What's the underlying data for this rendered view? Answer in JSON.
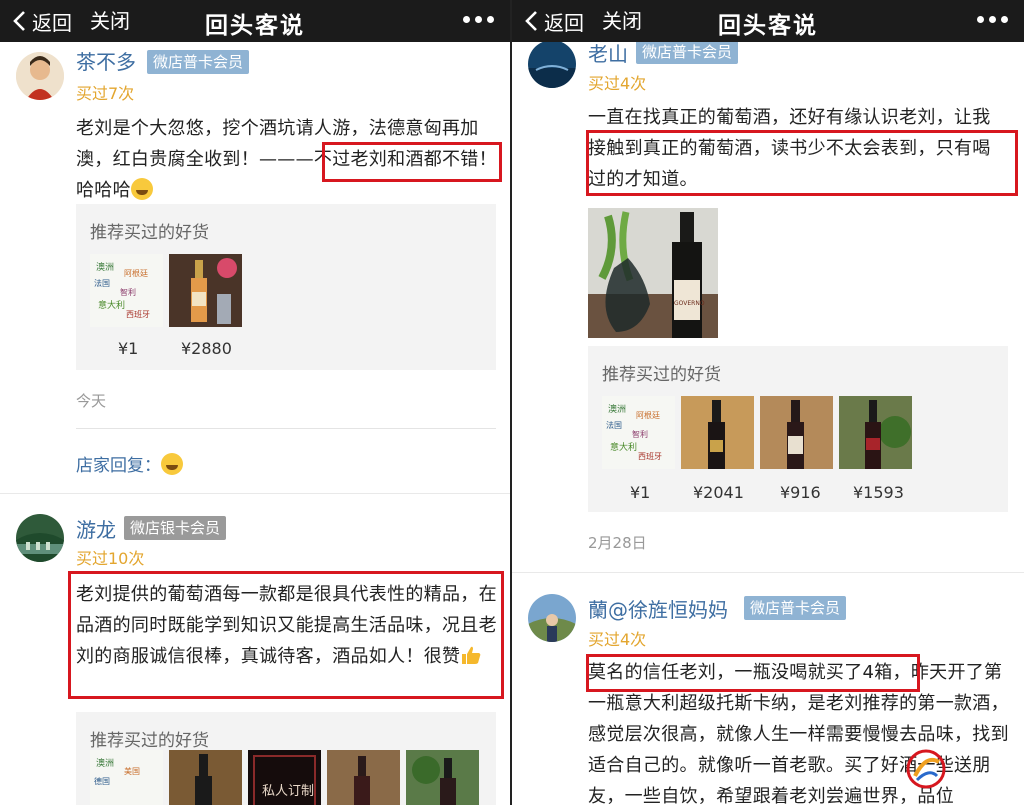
{
  "nav": {
    "back": "返回",
    "close": "关闭",
    "title": "回头客说"
  },
  "left": {
    "c1": {
      "name": "茶不多",
      "badge": "微店普卡会员",
      "bought": "买过7次",
      "text_a": "老刘是个大忽悠，挖个酒坑请人游，法德意匈再加澳，红白贵腐全收到！———",
      "text_hl": "不过老刘和酒都不错",
      "text_b": "！哈哈哈",
      "rec_title": "推荐买过的好货",
      "prices": [
        "¥1",
        "¥2880"
      ],
      "date": "今天",
      "reply": "店家回复："
    },
    "c2": {
      "name": "游龙",
      "badge": "微店银卡会员",
      "bought": "买过10次",
      "text": "老刘提供的葡萄酒每一款都是很具代表性的精品，在品酒的同时既能学到知识又能提高生活品味，况且老刘的商服诚信很棒，真诚待客，酒品如人！很赞",
      "rec_title": "推荐买过的好货",
      "thumb_label": "私人订制"
    }
  },
  "right": {
    "c1": {
      "name": "老山",
      "badge": "微店普卡会员",
      "bought": "买过4次",
      "line1": "一直在找真正的葡萄酒，还好有缘认识老刘，让我",
      "line2": "接触到真正的葡萄酒，读书少不太会表到，只有喝",
      "line3": "过的才知道。",
      "photo_label": "GOVERNO",
      "rec_title": "推荐买过的好货",
      "prices": [
        "¥1",
        "¥2041",
        "¥916",
        "¥1593"
      ],
      "date": "2月28日"
    },
    "c2": {
      "name": "蘭@徐旌恒妈妈",
      "badge": "微店普卡会员",
      "bought": "买过4次",
      "text_hl": "莫名的信任老刘，一瓶没喝就买了4箱，",
      "text_a": "昨天开了第一瓶意大利超级托斯卡纳，是老刘推荐的第一款酒，感觉层次很高，就像人生一样需要慢慢去品味，找到适合自己的。就像听一首老歌。",
      "text_b": "买了好酒一些送朋友，一些自饮，希望跟着老刘尝遍世界，品位"
    }
  },
  "cloud_words": [
    "澳洲",
    "阿根廷",
    "法国",
    "智利",
    "意大利",
    "西班牙",
    "美国",
    "德国"
  ],
  "colors": {
    "nav_bg": "#1b1b1b",
    "name_blue": "#3e6ea2",
    "bought_gold": "#e3a62f",
    "highlight_red": "#d7171f",
    "badge_blue": "#8fb3d3",
    "badge_gray": "#9a9a9a"
  }
}
